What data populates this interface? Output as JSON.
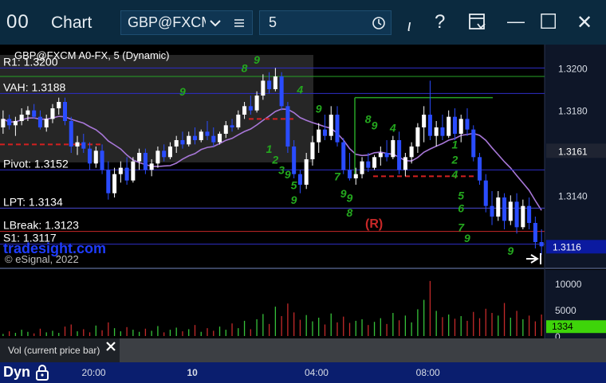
{
  "window": {
    "logo_glyph": "00",
    "title": "Chart",
    "symbol": "GBP@FXCM",
    "interval": "5",
    "cursor_glyph": "ι",
    "help_glyph": "?",
    "minimize_glyph": "—",
    "maximize_glyph": "☐",
    "close_glyph": "✕"
  },
  "icons": {
    "logo": "app-logo-icon",
    "dropdown": "chevron-down-icon",
    "menu": "hamburger-menu-icon",
    "clock": "clock-icon",
    "cursor": "cursor-icon",
    "help": "help-icon",
    "layout": "layout-dropdown-icon",
    "minimize": "minimize-icon",
    "maximize": "maximize-icon",
    "close": "close-icon",
    "lock": "lock-icon",
    "scroll_end": "scroll-to-end-icon"
  },
  "chart": {
    "symbol_label": "GBP@FXCM A0-FX, 5 (Dynamic)",
    "watermark": "tradesight.com",
    "copyright": "© eSignal, 2022",
    "r_marker": "(R)"
  },
  "chart_data": {
    "type": "candlestick",
    "ylim": [
      1.3106,
      1.3211
    ],
    "y_ticks": [
      "1.3200",
      "1.3180",
      "1.3140"
    ],
    "current_price_label": "1.3161",
    "last_price_label": "1.3116",
    "ohlc": [
      [
        1.3172,
        1.318,
        1.3169,
        1.3176
      ],
      [
        1.3176,
        1.3178,
        1.3171,
        1.3173
      ],
      [
        1.3173,
        1.3177,
        1.3168,
        1.3175
      ],
      [
        1.3175,
        1.3181,
        1.3173,
        1.3178
      ],
      [
        1.3178,
        1.3182,
        1.3175,
        1.318
      ],
      [
        1.318,
        1.3183,
        1.3176,
        1.3177
      ],
      [
        1.3177,
        1.318,
        1.3171,
        1.3172
      ],
      [
        1.3172,
        1.3178,
        1.317,
        1.3176
      ],
      [
        1.3176,
        1.3183,
        1.3174,
        1.3181
      ],
      [
        1.3181,
        1.3186,
        1.3178,
        1.3184
      ],
      [
        1.3184,
        1.3186,
        1.3173,
        1.3175
      ],
      [
        1.3175,
        1.3177,
        1.316,
        1.3163
      ],
      [
        1.3163,
        1.3168,
        1.3159,
        1.3165
      ],
      [
        1.3165,
        1.3169,
        1.316,
        1.3162
      ],
      [
        1.3162,
        1.3165,
        1.3152,
        1.3155
      ],
      [
        1.3155,
        1.3163,
        1.3153,
        1.3161
      ],
      [
        1.3161,
        1.3164,
        1.315,
        1.3152
      ],
      [
        1.3152,
        1.3156,
        1.3138,
        1.3141
      ],
      [
        1.3141,
        1.3153,
        1.3139,
        1.315
      ],
      [
        1.315,
        1.3156,
        1.3146,
        1.3153
      ],
      [
        1.3153,
        1.3158,
        1.3145,
        1.3147
      ],
      [
        1.3147,
        1.3158,
        1.3146,
        1.3156
      ],
      [
        1.3156,
        1.3162,
        1.3152,
        1.316
      ],
      [
        1.316,
        1.3162,
        1.315,
        1.3152
      ],
      [
        1.3152,
        1.3157,
        1.3149,
        1.3155
      ],
      [
        1.3155,
        1.3163,
        1.3153,
        1.3161
      ],
      [
        1.3161,
        1.3164,
        1.3156,
        1.3158
      ],
      [
        1.3158,
        1.3165,
        1.3157,
        1.3163
      ],
      [
        1.3163,
        1.3168,
        1.316,
        1.3166
      ],
      [
        1.3166,
        1.317,
        1.3162,
        1.3164
      ],
      [
        1.3164,
        1.317,
        1.3163,
        1.3168
      ],
      [
        1.3168,
        1.3172,
        1.3164,
        1.3166
      ],
      [
        1.3166,
        1.3171,
        1.3165,
        1.317
      ],
      [
        1.317,
        1.3175,
        1.3166,
        1.3168
      ],
      [
        1.3168,
        1.3172,
        1.3163,
        1.3165
      ],
      [
        1.3165,
        1.317,
        1.3164,
        1.3169
      ],
      [
        1.3169,
        1.3175,
        1.3167,
        1.3173
      ],
      [
        1.3173,
        1.3176,
        1.317,
        1.3172
      ],
      [
        1.3172,
        1.318,
        1.3171,
        1.3178
      ],
      [
        1.3178,
        1.3184,
        1.3176,
        1.3182
      ],
      [
        1.3182,
        1.3187,
        1.3178,
        1.318
      ],
      [
        1.318,
        1.3189,
        1.3179,
        1.3187
      ],
      [
        1.3187,
        1.3197,
        1.3185,
        1.3194
      ],
      [
        1.3194,
        1.3198,
        1.3188,
        1.319
      ],
      [
        1.319,
        1.32,
        1.3189,
        1.3196
      ],
      [
        1.3196,
        1.3198,
        1.318,
        1.3182
      ],
      [
        1.3182,
        1.3184,
        1.316,
        1.3163
      ],
      [
        1.3163,
        1.3166,
        1.3148,
        1.315
      ],
      [
        1.315,
        1.3152,
        1.3141,
        1.3145
      ],
      [
        1.3145,
        1.316,
        1.3143,
        1.3157
      ],
      [
        1.3157,
        1.3168,
        1.3154,
        1.3165
      ],
      [
        1.3165,
        1.3174,
        1.316,
        1.3171
      ],
      [
        1.3171,
        1.3178,
        1.3166,
        1.3168
      ],
      [
        1.3168,
        1.3182,
        1.3166,
        1.3178
      ],
      [
        1.3178,
        1.3182,
        1.3163,
        1.3165
      ],
      [
        1.3165,
        1.3167,
        1.315,
        1.3152
      ],
      [
        1.3152,
        1.316,
        1.3147,
        1.3148
      ],
      [
        1.3148,
        1.3153,
        1.3145,
        1.315
      ],
      [
        1.315,
        1.3158,
        1.3148,
        1.3156
      ],
      [
        1.3156,
        1.316,
        1.3151,
        1.3153
      ],
      [
        1.3153,
        1.3159,
        1.3152,
        1.3158
      ],
      [
        1.3158,
        1.3163,
        1.3154,
        1.316
      ],
      [
        1.316,
        1.3166,
        1.3156,
        1.3158
      ],
      [
        1.3158,
        1.3168,
        1.3157,
        1.3166
      ],
      [
        1.3166,
        1.317,
        1.315,
        1.3152
      ],
      [
        1.3152,
        1.316,
        1.3149,
        1.3158
      ],
      [
        1.3158,
        1.3165,
        1.3155,
        1.3163
      ],
      [
        1.3163,
        1.3174,
        1.316,
        1.3172
      ],
      [
        1.3172,
        1.3182,
        1.3165,
        1.3178
      ],
      [
        1.3178,
        1.3194,
        1.3166,
        1.3168
      ],
      [
        1.3168,
        1.3175,
        1.3163,
        1.3172
      ],
      [
        1.3172,
        1.3178,
        1.3166,
        1.3168
      ],
      [
        1.3168,
        1.318,
        1.3167,
        1.3177
      ],
      [
        1.3177,
        1.3181,
        1.3166,
        1.3169
      ],
      [
        1.3169,
        1.3178,
        1.3165,
        1.3176
      ],
      [
        1.3176,
        1.3181,
        1.3168,
        1.3171
      ],
      [
        1.3171,
        1.3173,
        1.3156,
        1.3158
      ],
      [
        1.3158,
        1.316,
        1.3145,
        1.3147
      ],
      [
        1.3147,
        1.315,
        1.3132,
        1.3135
      ],
      [
        1.3135,
        1.3142,
        1.3126,
        1.313
      ],
      [
        1.313,
        1.3142,
        1.3128,
        1.3139
      ],
      [
        1.3139,
        1.3141,
        1.3124,
        1.3128
      ],
      [
        1.3128,
        1.314,
        1.3126,
        1.3137
      ],
      [
        1.3137,
        1.3141,
        1.3122,
        1.3125
      ],
      [
        1.3125,
        1.3138,
        1.3124,
        1.3135
      ],
      [
        1.3135,
        1.3139,
        1.3124,
        1.3127
      ],
      [
        1.3127,
        1.313,
        1.3115,
        1.3118
      ],
      [
        1.3118,
        1.3124,
        1.3112,
        1.3116
      ]
    ],
    "volume": [
      400,
      900,
      600,
      1200,
      800,
      500,
      1400,
      700,
      1000,
      600,
      1800,
      2200,
      900,
      1300,
      700,
      2000,
      1100,
      2600,
      1500,
      900,
      1700,
      1200,
      800,
      1400,
      1000,
      1900,
      700,
      1200,
      1600,
      900,
      1300,
      2100,
      800,
      1500,
      1000,
      1800,
      1200,
      2400,
      1500,
      2900,
      1300,
      3200,
      4200,
      2300,
      5600,
      3800,
      6200,
      4500,
      3100,
      4000,
      2800,
      3500,
      2200,
      4300,
      2600,
      3700,
      2500,
      2900,
      3200,
      2100,
      2700,
      3400,
      2300,
      4400,
      3000,
      3900,
      2600,
      5100,
      6900,
      10500,
      4800,
      3600,
      4100,
      3300,
      3800,
      2900,
      4600,
      3400,
      5200,
      4400,
      3900,
      6300,
      3500,
      4800,
      3200,
      3900,
      2800,
      4100
    ],
    "volume_ylim": [
      0,
      12000
    ],
    "volume_ticks": [
      "10000",
      "5000",
      "0"
    ],
    "current_volume_label": "1334",
    "volume_label": "Vol (current price bar)",
    "levels": [
      {
        "label": "R1: 1.3200",
        "value": 1.32,
        "color": "#2e2ec8"
      },
      {
        "label": "VAH: 1.3188",
        "value": 1.3188,
        "color": "#2e2ec8"
      },
      {
        "label": "Pivot: 1.3152",
        "value": 1.3152,
        "color": "#2e2ec8"
      },
      {
        "label": "LPT: 1.3134",
        "value": 1.3134,
        "color": "#4a4ad0"
      },
      {
        "label": "LBreak: 1.3123",
        "value": 1.3123,
        "color": "#c82828"
      },
      {
        "label": "S1: 1.3117",
        "value": 1.3117,
        "color": "#2e2ec8"
      }
    ],
    "seq_counts": [
      {
        "text": "9",
        "bar": 41,
        "value": 1.3202,
        "color": "#24a81e"
      },
      {
        "text": "8",
        "bar": 39,
        "value": 1.3198,
        "color": "#24a81e"
      },
      {
        "text": "9",
        "bar": 29,
        "value": 1.3187,
        "color": "#24a81e"
      },
      {
        "text": "4",
        "bar": 48,
        "value": 1.3188,
        "color": "#24a81e"
      },
      {
        "text": "9",
        "bar": 51,
        "value": 1.3179,
        "color": "#24a81e"
      },
      {
        "text": "8",
        "bar": 59,
        "value": 1.3174,
        "color": "#24a81e"
      },
      {
        "text": "9",
        "bar": 60,
        "value": 1.3171,
        "color": "#24a81e"
      },
      {
        "text": "4",
        "bar": 63,
        "value": 1.317,
        "color": "#24a81e"
      },
      {
        "text": "1",
        "bar": 43,
        "value": 1.316,
        "color": "#24a81e"
      },
      {
        "text": "2",
        "bar": 44,
        "value": 1.3155,
        "color": "#24a81e"
      },
      {
        "text": "3",
        "bar": 45,
        "value": 1.315,
        "color": "#24a81e"
      },
      {
        "text": "9",
        "bar": 46,
        "value": 1.3148,
        "color": "#24a81e"
      },
      {
        "text": "5",
        "bar": 47,
        "value": 1.3143,
        "color": "#24a81e"
      },
      {
        "text": "9",
        "bar": 47,
        "value": 1.3136,
        "color": "#24a81e"
      },
      {
        "text": "7",
        "bar": 54,
        "value": 1.3147,
        "color": "#24a81e"
      },
      {
        "text": "9",
        "bar": 55,
        "value": 1.3139,
        "color": "#24a81e"
      },
      {
        "text": "9",
        "bar": 56,
        "value": 1.3137,
        "color": "#24a81e"
      },
      {
        "text": "8",
        "bar": 56,
        "value": 1.313,
        "color": "#24a81e"
      },
      {
        "text": "1",
        "bar": 73,
        "value": 1.3162,
        "color": "#24a81e"
      },
      {
        "text": "2",
        "bar": 73,
        "value": 1.3155,
        "color": "#24a81e"
      },
      {
        "text": "4",
        "bar": 73,
        "value": 1.3148,
        "color": "#24a81e"
      },
      {
        "text": "5",
        "bar": 74,
        "value": 1.3138,
        "color": "#24a81e"
      },
      {
        "text": "6",
        "bar": 74,
        "value": 1.3132,
        "color": "#24a81e"
      },
      {
        "text": "7",
        "bar": 74,
        "value": 1.3123,
        "color": "#24a81e"
      },
      {
        "text": "9",
        "bar": 75,
        "value": 1.3118,
        "color": "#24a81e"
      },
      {
        "text": "9",
        "bar": 82,
        "value": 1.3112,
        "color": "#24a81e"
      }
    ],
    "x_ticks": [
      {
        "label": "20:00",
        "bar": 14
      },
      {
        "label": "10",
        "bar": 31
      },
      {
        "label": "04:00",
        "bar": 50
      },
      {
        "label": "08:00",
        "bar": 68
      }
    ],
    "x_marker": "Dyn"
  }
}
